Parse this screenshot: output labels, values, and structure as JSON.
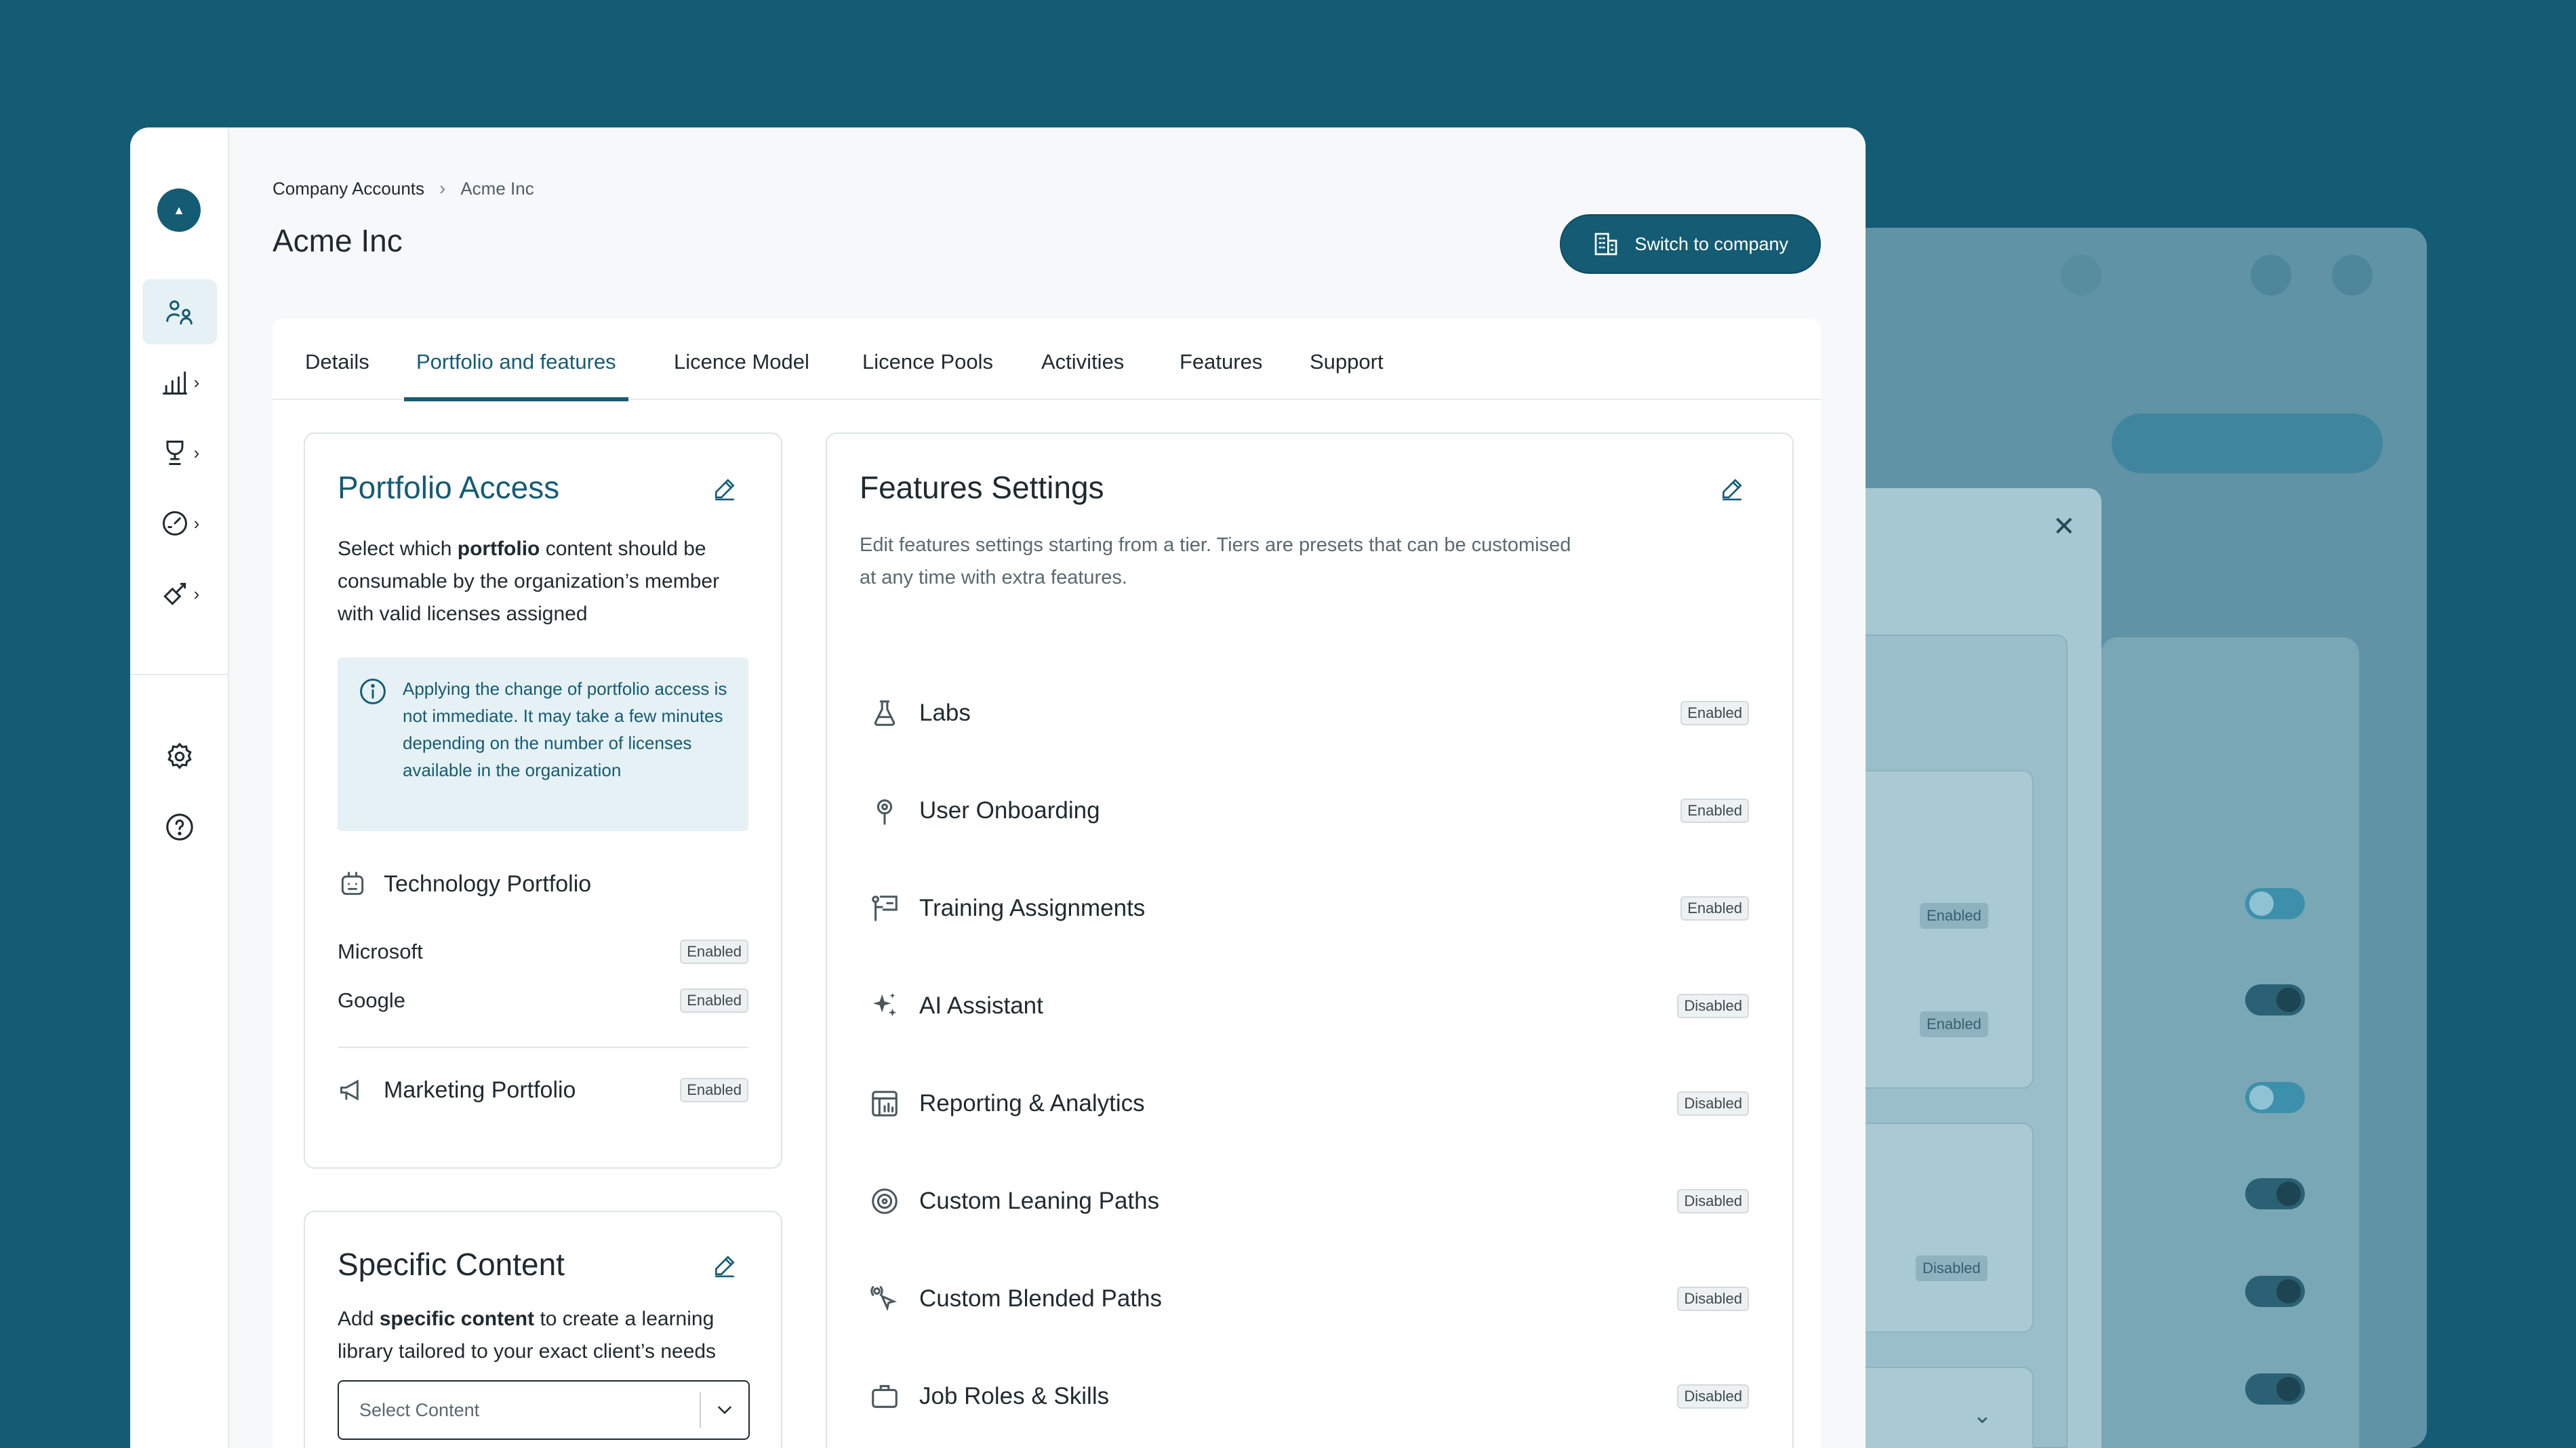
{
  "breadcrumb": {
    "root": "Company Accounts",
    "current": "Acme Inc"
  },
  "page_title": "Acme Inc",
  "switch_button": "Switch to company",
  "tabs": [
    {
      "label": "Details"
    },
    {
      "label": "Portfolio and features",
      "active": true
    },
    {
      "label": "Licence Model"
    },
    {
      "label": "Licence Pools"
    },
    {
      "label": "Activities"
    },
    {
      "label": "Features"
    },
    {
      "label": "Support"
    }
  ],
  "sidebar": {
    "items": [
      {
        "icon": "users-icon",
        "active": true
      },
      {
        "icon": "analytics-icon",
        "has_chevron": true
      },
      {
        "icon": "trophy-icon",
        "has_chevron": true
      },
      {
        "icon": "gauge-icon",
        "has_chevron": true
      },
      {
        "icon": "tools-icon",
        "has_chevron": true
      }
    ],
    "bottom": [
      {
        "icon": "gear-icon"
      },
      {
        "icon": "help-icon"
      }
    ]
  },
  "portfolio_access": {
    "title": "Portfolio Access",
    "desc_pre": "Select which ",
    "desc_bold": "portfolio",
    "desc_post": " content should be consumable by the organization’s member with valid licenses assigned",
    "info": "Applying the change of portfolio access is not immediate. It may take a few minutes depending on the number of licenses available in the organization",
    "technology": {
      "title": "Technology Portfolio",
      "items": [
        {
          "name": "Microsoft",
          "status": "Enabled"
        },
        {
          "name": "Google",
          "status": "Enabled"
        }
      ]
    },
    "marketing": {
      "title": "Marketing Portfolio",
      "status": "Enabled"
    }
  },
  "specific_content": {
    "title": "Specific Content",
    "desc_pre": "Add ",
    "desc_bold": "specific content",
    "desc_post": " to create a learning library tailored to your exact client’s needs",
    "select_placeholder": "Select Content"
  },
  "features_settings": {
    "title": "Features Settings",
    "desc": "Edit features settings starting from a tier. Tiers are presets that can be customised at any time with extra features.",
    "items": [
      {
        "name": "Labs",
        "status": "Enabled",
        "icon": "flask-icon"
      },
      {
        "name": "User Onboarding",
        "status": "Enabled",
        "icon": "map-pin-icon"
      },
      {
        "name": "Training Assignments",
        "status": "Enabled",
        "icon": "presentation-icon"
      },
      {
        "name": "AI Assistant",
        "status": "Disabled",
        "icon": "sparkle-icon"
      },
      {
        "name": "Reporting & Analytics",
        "status": "Disabled",
        "icon": "report-icon"
      },
      {
        "name": "Custom Leaning Paths",
        "status": "Disabled",
        "icon": "target-icon"
      },
      {
        "name": "Custom Blended Paths",
        "status": "Disabled",
        "icon": "blended-icon"
      },
      {
        "name": "Job Roles & Skills",
        "status": "Disabled",
        "icon": "briefcase-icon"
      }
    ]
  },
  "background": {
    "badges": [
      "Enabled",
      "Enabled",
      "Disabled"
    ],
    "toggles": [
      "on",
      "off",
      "on",
      "off",
      "off",
      "off"
    ]
  }
}
